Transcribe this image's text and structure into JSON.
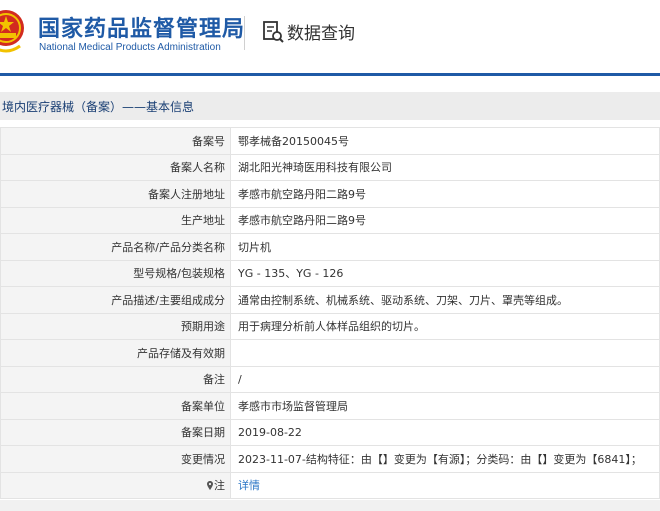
{
  "header": {
    "brand_cn": "国家药品监督管理局",
    "brand_en": "National Medical Products Administration",
    "query_label": "数据查询"
  },
  "breadcrumb": "境内医疗器械（备案）——基本信息",
  "rows": [
    {
      "key": "备案号",
      "value": "鄂孝械备20150045号"
    },
    {
      "key": "备案人名称",
      "value": "湖北阳光神琦医用科技有限公司"
    },
    {
      "key": "备案人注册地址",
      "value": "孝感市航空路丹阳二路9号"
    },
    {
      "key": "生产地址",
      "value": "孝感市航空路丹阳二路9号"
    },
    {
      "key": "产品名称/产品分类名称",
      "value": "切片机"
    },
    {
      "key": "型号规格/包装规格",
      "value": "YG - 135、YG - 126"
    },
    {
      "key": "产品描述/主要组成成分",
      "value": "通常由控制系统、机械系统、驱动系统、刀架、刀片、罩壳等组成。"
    },
    {
      "key": "预期用途",
      "value": "用于病理分析前人体样品组织的切片。"
    },
    {
      "key": "产品存储及有效期",
      "value": ""
    },
    {
      "key": "备注",
      "value": "/"
    },
    {
      "key": "备案单位",
      "value": "孝感市市场监督管理局"
    },
    {
      "key": "备案日期",
      "value": "2019-08-22"
    },
    {
      "key": "变更情况",
      "value": "2023-11-07-结构特征：由【】变更为【有源】；分类码：由【】变更为【6841】；"
    }
  ],
  "note_row": {
    "key": "注",
    "link_label": "详情"
  },
  "colors": {
    "brand_blue": "#1f5aa6",
    "link_blue": "#2a75c6",
    "emblem_red": "#d22b1f",
    "emblem_gold": "#f2c200"
  },
  "icons": {
    "emblem": "national-emblem",
    "query": "document-search-icon",
    "note": "map-pin-icon"
  }
}
